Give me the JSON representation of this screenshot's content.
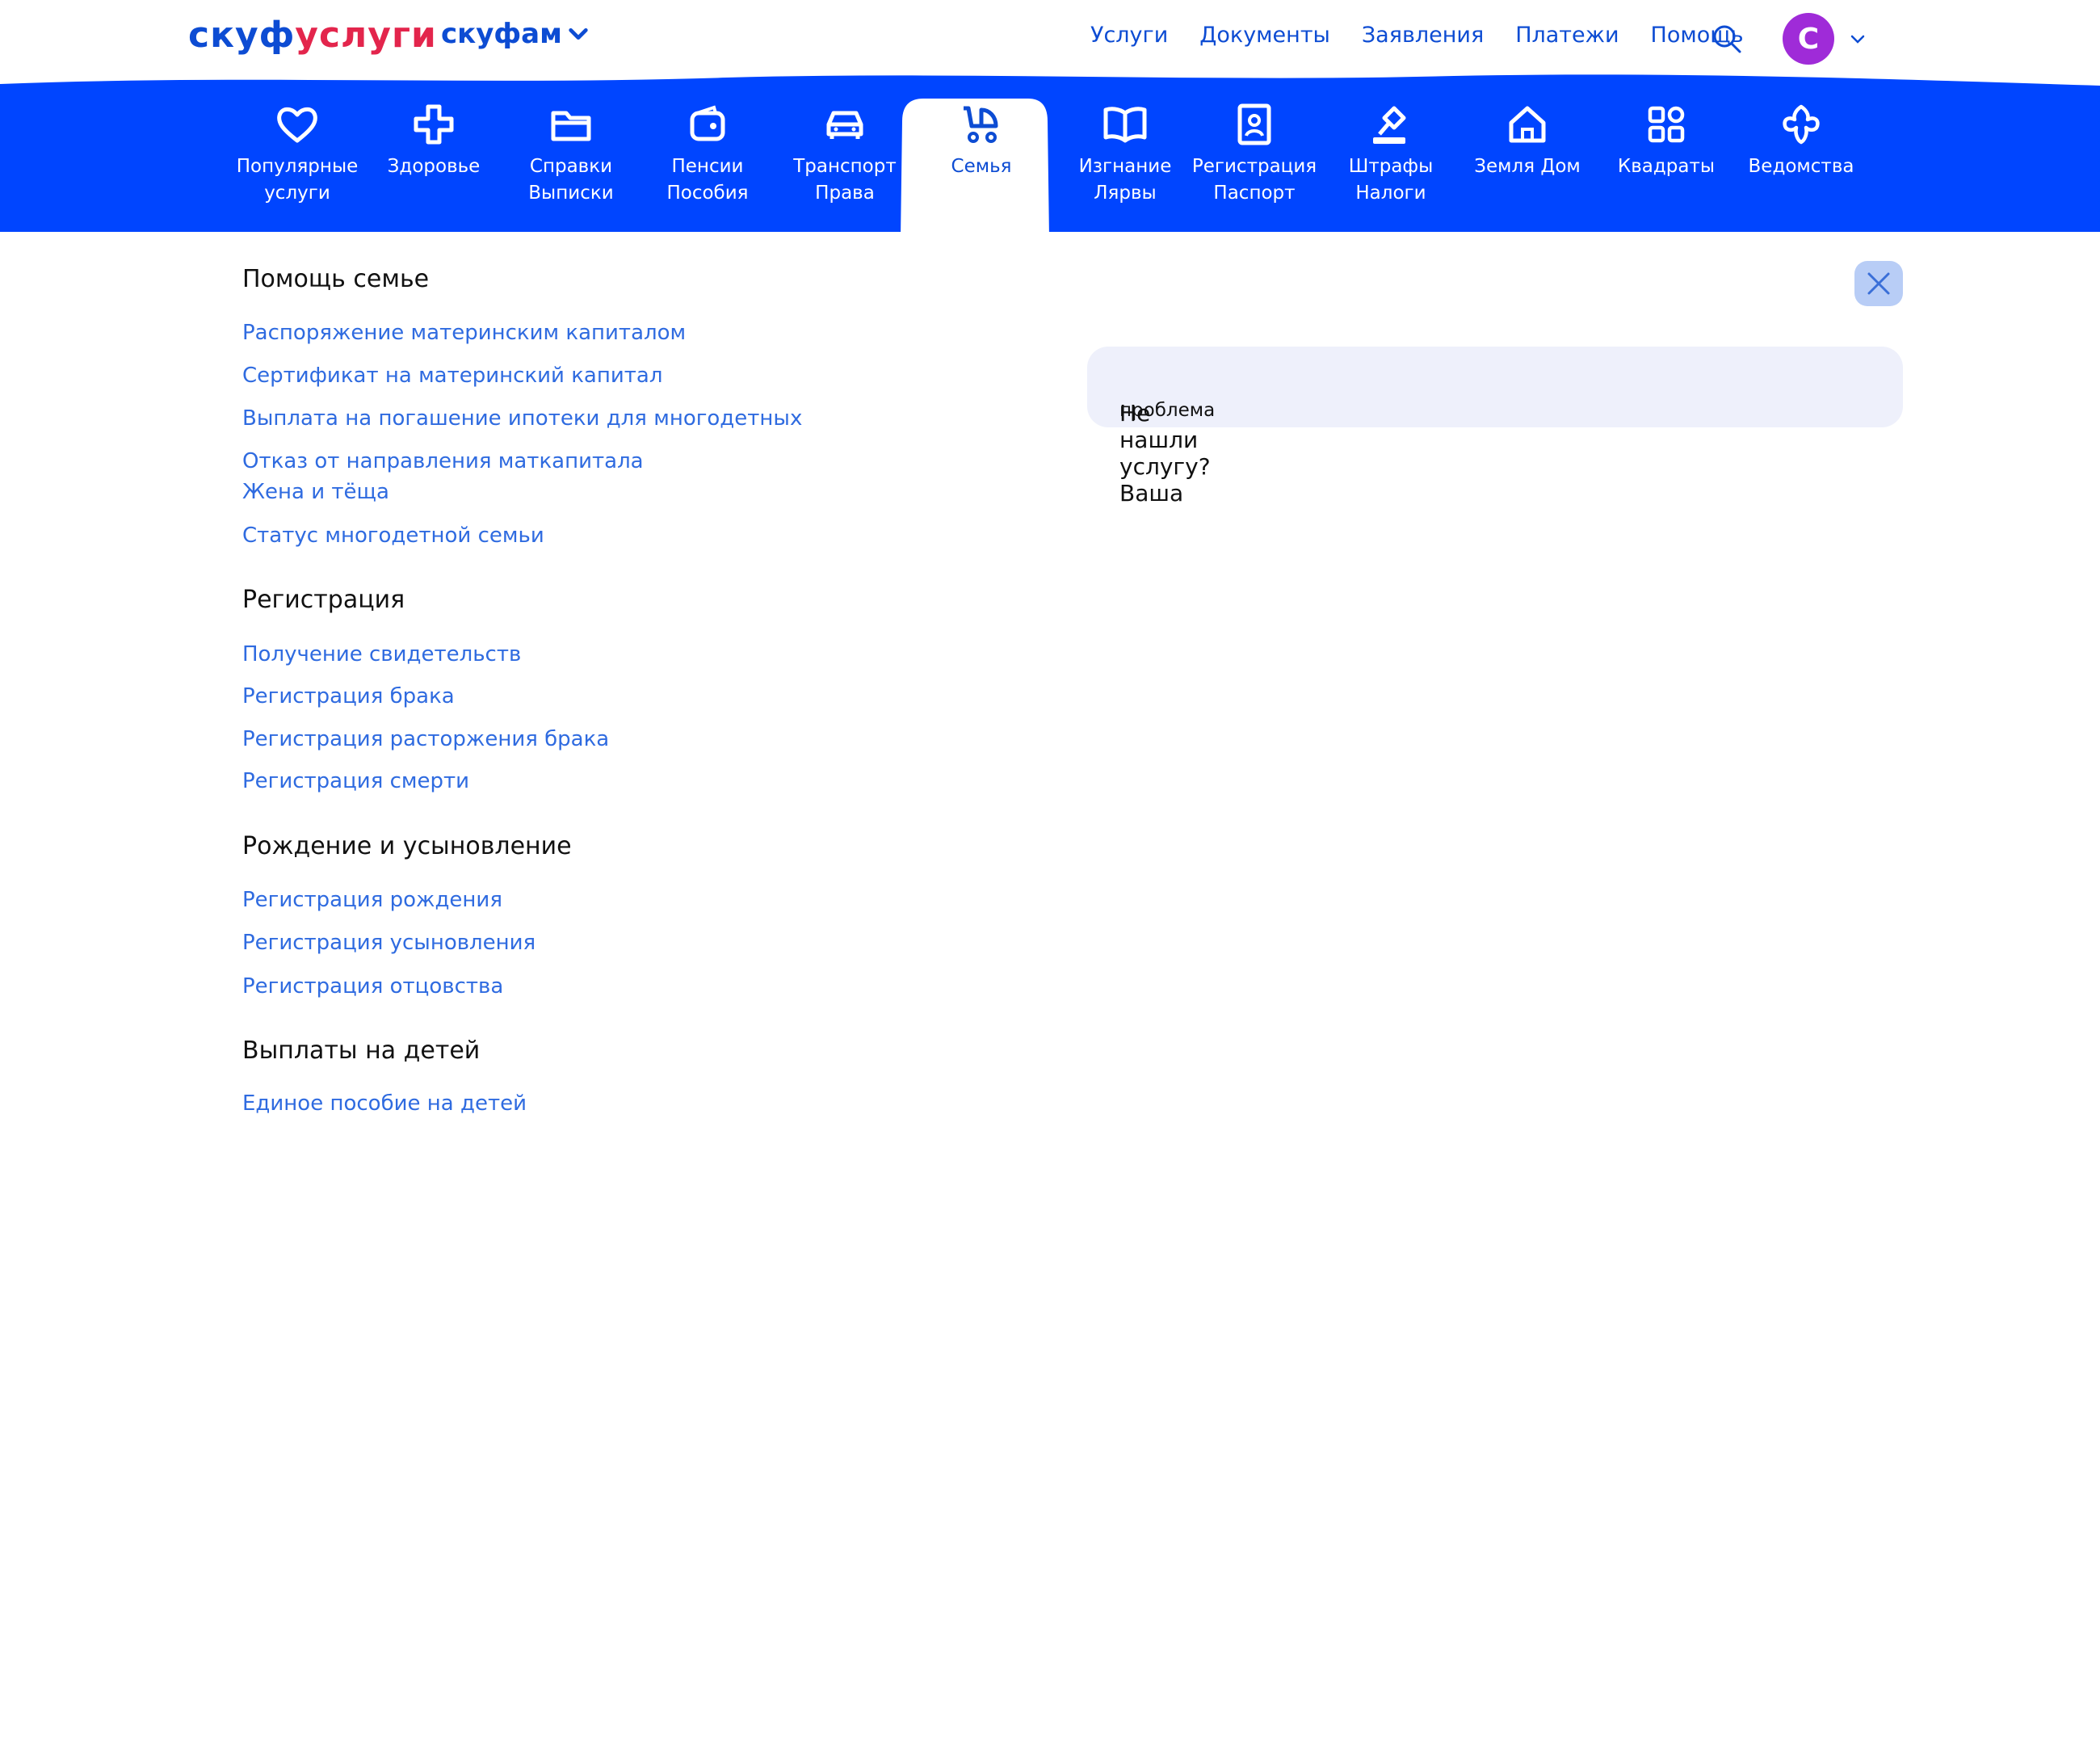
{
  "brand": {
    "part1": "скуф",
    "part2": "услуги",
    "sub": "скуфам",
    "colors": {
      "blue": "#0d4cd3",
      "red": "#e3254c"
    }
  },
  "topnav": [
    "Услуги",
    "Документы",
    "Заявления",
    "Платежи",
    "Помощь"
  ],
  "user": {
    "avatar_letter": "С",
    "avatar_color": "#9f2bd8"
  },
  "band_color": "#0045ff",
  "categories": [
    {
      "label": "Популярные\nуслуги",
      "icon": "heart-icon"
    },
    {
      "label": "Здоровье",
      "icon": "medical-cross-icon"
    },
    {
      "label": "Справки\nВыписки",
      "icon": "folder-icon"
    },
    {
      "label": "Пенсии\nПособия",
      "icon": "wallet-icon"
    },
    {
      "label": "Транспорт\nПрава",
      "icon": "car-icon"
    },
    {
      "label": "Семья",
      "icon": "stroller-icon",
      "active": true
    },
    {
      "label": "Изгнание\nЛярвы",
      "icon": "book-icon"
    },
    {
      "label": "Регистрация\nПаспорт",
      "icon": "passport-icon"
    },
    {
      "label": "Штрафы\nНалоги",
      "icon": "gavel-icon"
    },
    {
      "label": "Земля Дом",
      "icon": "house-icon"
    },
    {
      "label": "Квадраты",
      "icon": "squares-icon"
    },
    {
      "label": "Ведомства",
      "icon": "emblem-icon"
    }
  ],
  "sections": [
    {
      "title": "Помощь семье",
      "links": [
        "Распоряжение материнским капиталом",
        "Сертификат на материнский капитал",
        "Выплата на погашение ипотеки для многодетных",
        "Отказ от направления маткапитала",
        "Жена  и тёща",
        "Статус многодетной семьи"
      ]
    },
    {
      "title": "Регистрация",
      "links": [
        "Получение свидетельств",
        "Регистрация брака",
        "Регистрация расторжения брака",
        "Регистрация смерти"
      ]
    },
    {
      "title": "Рождение и усыновление",
      "links": [
        "Регистрация рождения",
        "Регистрация усыновления",
        "Регистрация отцовства"
      ]
    },
    {
      "title": "Выплаты на детей",
      "links": [
        "Единое пособие на детей"
      ]
    }
  ],
  "not_found": {
    "text": "Не нашли услугу?  Ваша",
    "extra": "проблема"
  }
}
